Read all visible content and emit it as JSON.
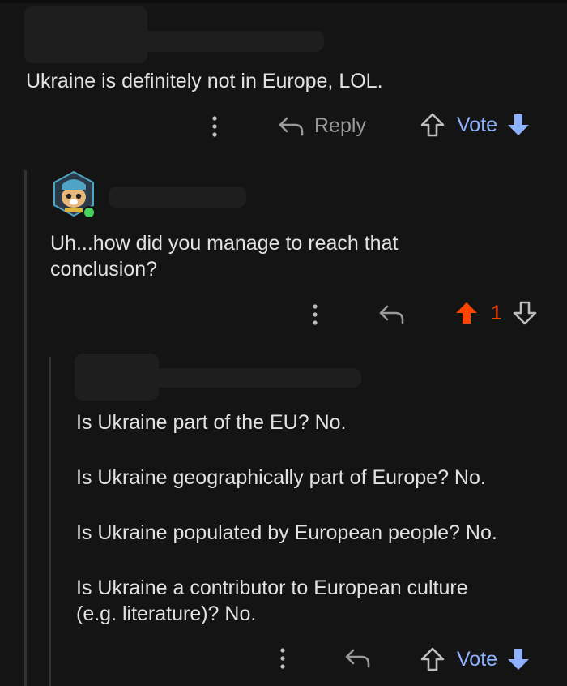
{
  "comments": [
    {
      "body": "Ukraine is definitely not in Europe, LOL.",
      "actions": {
        "reply_label": "Reply",
        "vote_label": "Vote"
      }
    },
    {
      "body_lines": [
        "Uh...how did you manage to reach that",
        "conclusion?"
      ],
      "vote_count": "1",
      "online": true
    },
    {
      "paragraphs": [
        "Is Ukraine part of the EU? No.",
        "Is Ukraine geographically part of Europe? No.",
        "Is Ukraine populated by European people? No.",
        "Is Ukraine a contributor to European culture",
        "(e.g. literature)? No."
      ],
      "actions": {
        "vote_label": "Vote"
      }
    }
  ],
  "colors": {
    "background": "#141414",
    "vote_blue": "#8eb1ff",
    "upvote_orange": "#ff4500",
    "online_green": "#46d160"
  },
  "icons": [
    "more-options-icon",
    "reply-arrow-icon",
    "upvote-outline-icon",
    "downvote-filled-icon",
    "upvote-filled-icon",
    "downvote-outline-icon"
  ]
}
